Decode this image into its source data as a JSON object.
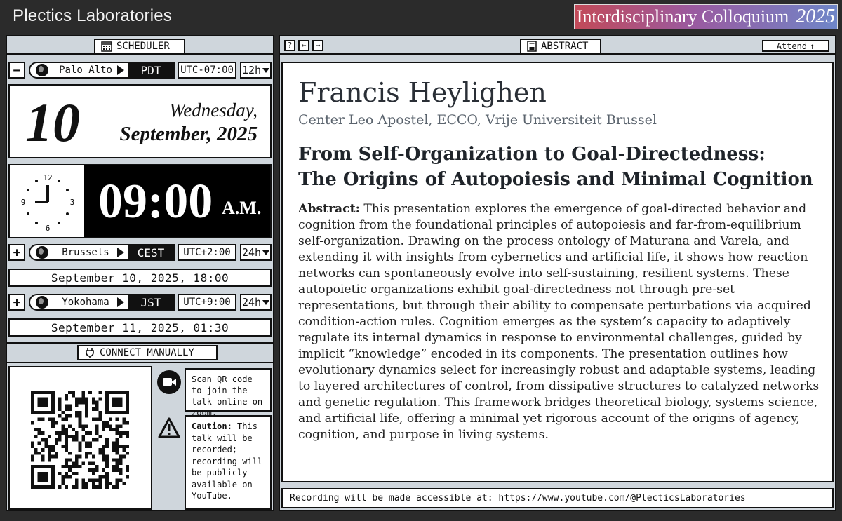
{
  "header": {
    "app_title": "Plectics Laboratories",
    "banner_title": "Interdisciplinary Colloquium",
    "banner_year": "2025"
  },
  "scheduler": {
    "title": "SCHEDULER",
    "primary_tz": {
      "toggle": "−",
      "city": "Palo Alto",
      "abbr": "PDT",
      "offset": "UTC-07:00",
      "format": "12h"
    },
    "date": {
      "day": "10",
      "weekday": "Wednesday,",
      "month_year": "September, 2025"
    },
    "clock": {
      "time": "09:00",
      "ampm": "A.M.",
      "dial": [
        "12",
        "3",
        "6",
        "9"
      ]
    },
    "zones": [
      {
        "toggle": "+",
        "city": "Brussels",
        "abbr": "CEST",
        "offset": "UTC+2:00",
        "format": "24h",
        "datetime": "September 10, 2025, 18:00"
      },
      {
        "toggle": "+",
        "city": "Yokohama",
        "abbr": "JST",
        "offset": "UTC+9:00",
        "format": "24h",
        "datetime": "September 11, 2025, 01:30"
      }
    ]
  },
  "connect": {
    "title": "CONNECT MANUALLY",
    "zoom_note": "Scan QR code to join the talk online on Zoom.",
    "caution_label": "Caution:",
    "caution_text": "This talk will be recorded; recording will be publicly available on YouTube."
  },
  "abstract_panel": {
    "title": "ABSTRACT",
    "nav": [
      "?",
      "←",
      "→"
    ],
    "attend_label": "Attend",
    "speaker": "Francis Heylighen",
    "affiliation": "Center Leo Apostel, ECCO, Vrije Universiteit Brussel",
    "talk_title_1": "From Self-Organization to Goal-Directedness:",
    "talk_title_2": "The Origins of Autopoiesis and Minimal Cognition",
    "abstract_label": "Abstract:",
    "abstract_body": "This presentation explores the emergence of goal-directed behavior and cognition from the foundational principles of autopoiesis and far-from-equilibrium self-organization. Drawing on the process ontology of Maturana and Varela, and extending it with insights from cybernetics and artificial life, it shows how reaction networks can spontaneously evolve into self-sustaining, resilient systems. These autopoietic organizations exhibit goal-directedness not through pre-set representations, but through their ability to compensate perturbations via acquired condition-action rules. Cognition emerges as the system’s capacity to adaptively regulate its internal dynamics in response to environmental challenges, guided by implicit “knowledge” encoded in its components. The presentation outlines how evolutionary dynamics select for increasingly robust and adaptable systems, leading to layered architectures of control, from dissipative structures to catalyzed networks and genetic regulation. This framework bridges theoretical biology, systems science, and artificial life, offering a minimal yet rigorous account of the origins of agency, cognition, and purpose in living systems.",
    "footer": "Recording will be made accessible at: https://www.youtube.com/@PlecticsLaboratories"
  },
  "colors": {
    "background": "#2b2b2b",
    "panel": "#cfd6dc",
    "ink": "#111111",
    "banner_from": "#c24a58",
    "banner_to": "#6f86c8"
  }
}
